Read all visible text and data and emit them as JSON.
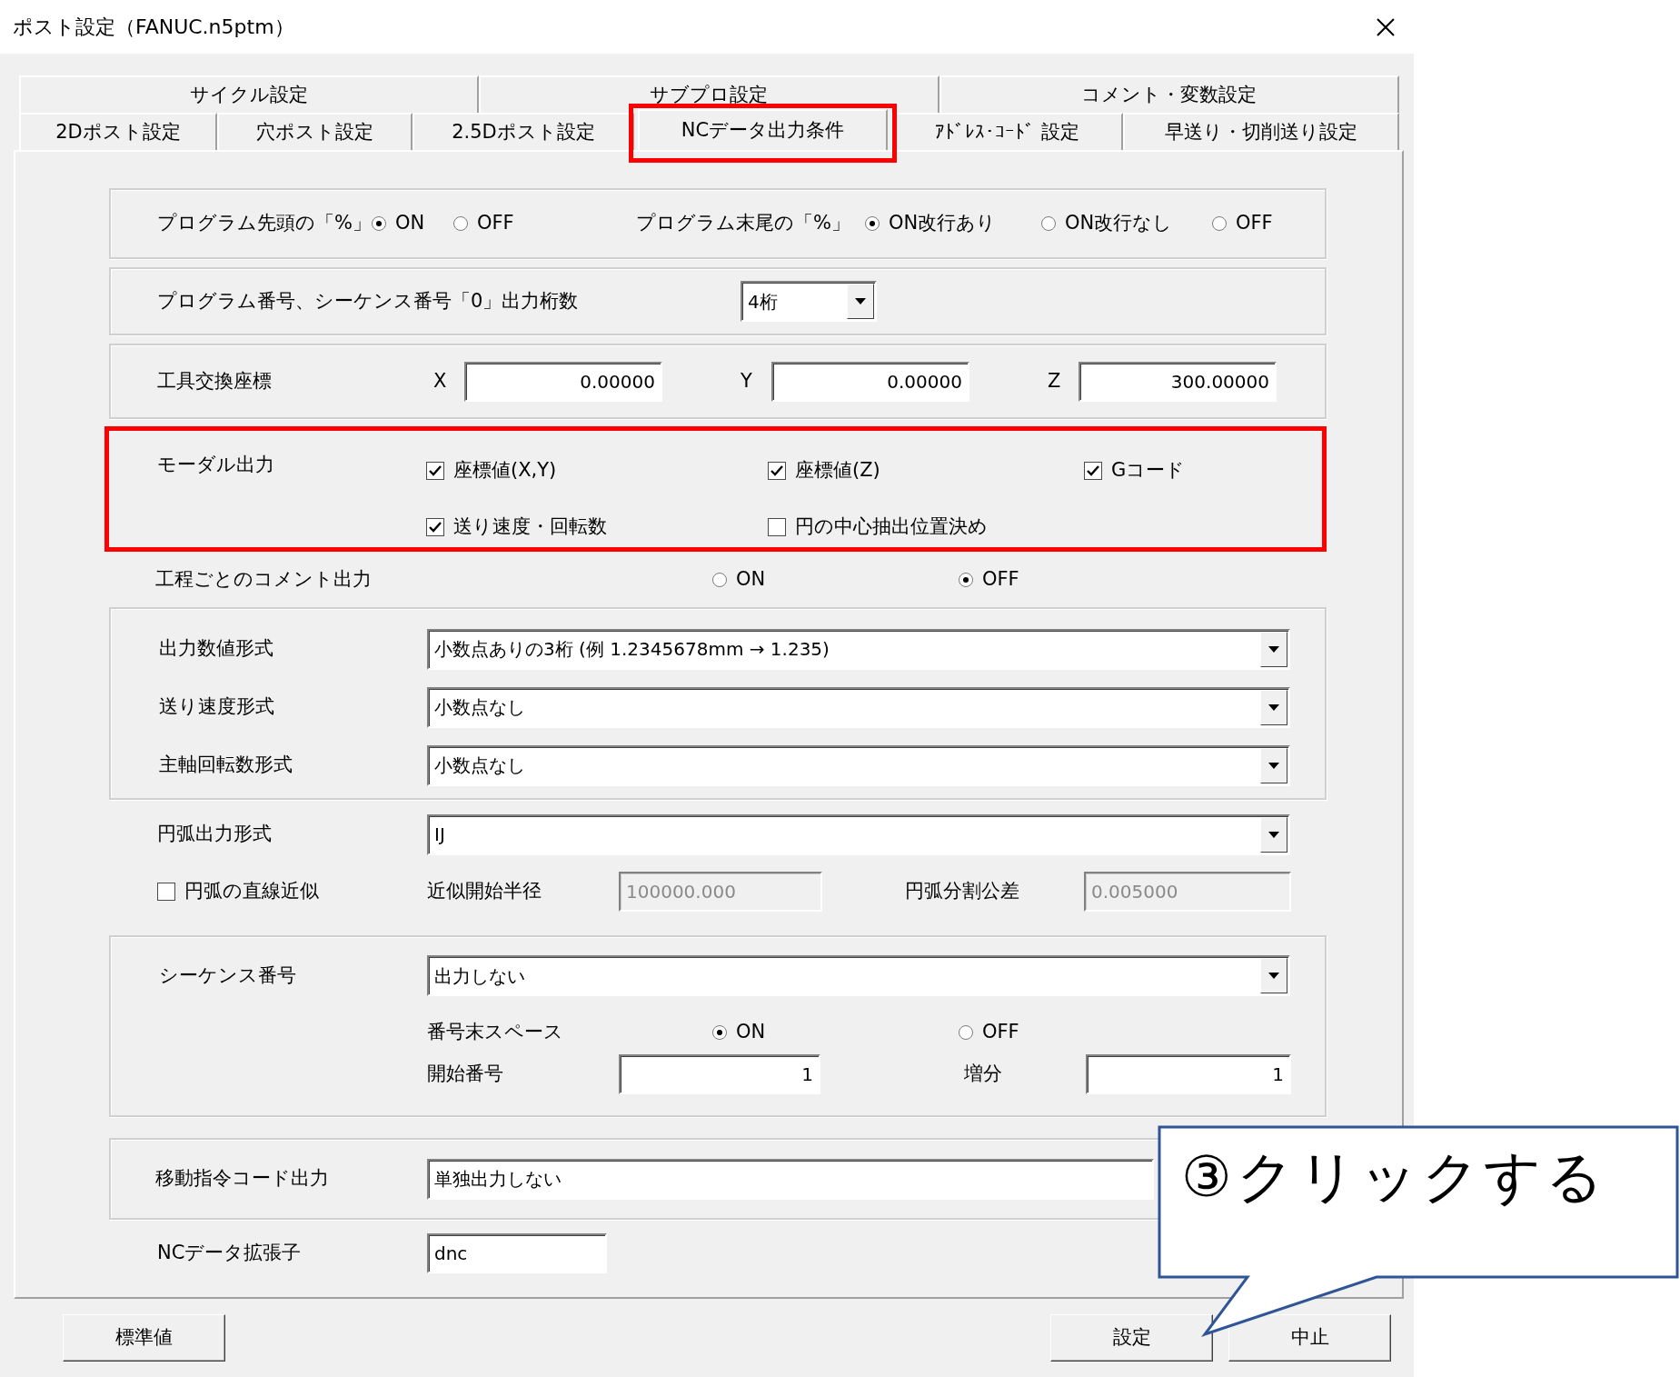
{
  "window": {
    "title": "ポスト設定（FANUC.n5ptm）"
  },
  "tab_rows": [
    {
      "tabs": [
        {
          "label": "サイクル設定",
          "selected": false,
          "highlighted": false
        },
        {
          "label": "サブプロ設定",
          "selected": false,
          "highlighted": false
        },
        {
          "label": "コメント・変数設定",
          "selected": false,
          "highlighted": false
        }
      ]
    },
    {
      "tabs": [
        {
          "label": "2Dポスト設定",
          "selected": false,
          "highlighted": false
        },
        {
          "label": "穴ポスト設定",
          "selected": false,
          "highlighted": false
        },
        {
          "label": "2.5Dポスト設定",
          "selected": false,
          "highlighted": false
        },
        {
          "label": "NCデータ出力条件",
          "selected": true,
          "highlighted": true
        },
        {
          "label": "ｱﾄﾞﾚｽ･ｺｰﾄﾞ 設定",
          "selected": false,
          "highlighted": false
        },
        {
          "label": "早送り・切削送り設定",
          "selected": false,
          "highlighted": false
        }
      ]
    }
  ],
  "percent": {
    "start_label": "プログラム先頭の「%」",
    "start_options": [
      {
        "label": "ON",
        "selected": true
      },
      {
        "label": "OFF",
        "selected": false
      }
    ],
    "end_label": "プログラム末尾の「%」",
    "end_options": [
      {
        "label": "ON改行あり",
        "selected": true
      },
      {
        "label": "ON改行なし",
        "selected": false
      },
      {
        "label": "OFF",
        "selected": false
      }
    ]
  },
  "digits": {
    "label": "プログラム番号、シーケンス番号「0」出力桁数",
    "value": "4桁"
  },
  "tool_change": {
    "label": "工具交換座標",
    "fields": [
      {
        "axis": "X",
        "value": "0.00000"
      },
      {
        "axis": "Y",
        "value": "0.00000"
      },
      {
        "axis": "Z",
        "value": "300.00000"
      }
    ]
  },
  "modal": {
    "label": "モーダル出力",
    "highlighted": true,
    "options": [
      {
        "label": "座標値(X,Y)",
        "checked": true
      },
      {
        "label": "座標値(Z)",
        "checked": true
      },
      {
        "label": "Gコード",
        "checked": true
      },
      {
        "label": "送り速度・回転数",
        "checked": true
      },
      {
        "label": "円の中心抽出位置決め",
        "checked": false
      }
    ]
  },
  "comment": {
    "label": "工程ごとのコメント出力",
    "options": [
      {
        "label": "ON",
        "selected": false
      },
      {
        "label": "OFF",
        "selected": true
      }
    ]
  },
  "formats": [
    {
      "label": "出力数値形式",
      "value": "小数点ありの3桁 (例 1.2345678mm → 1.235)"
    },
    {
      "label": "送り速度形式",
      "value": "小数点なし"
    },
    {
      "label": "主軸回転数形式",
      "value": "小数点なし"
    }
  ],
  "arc": {
    "label": "円弧出力形式",
    "value": "IJ"
  },
  "linear_approx": {
    "label": "円弧の直線近似",
    "checked": false,
    "disabled": true,
    "radius_label": "近似開始半径",
    "radius": "100000.000",
    "tolerance_label": "円弧分割公差",
    "tolerance": "0.005000"
  },
  "sequence": {
    "label": "シーケンス番号",
    "value": "出力しない",
    "space_label": "番号末スペース",
    "space_options": [
      {
        "label": "ON",
        "selected": true
      },
      {
        "label": "OFF",
        "selected": false
      }
    ],
    "start_label": "開始番号",
    "start": "1",
    "step_label": "増分",
    "step": "1"
  },
  "move_code": {
    "label": "移動指令コード出力",
    "value": "単独出力しない"
  },
  "extension": {
    "label": "NCデータ拡張子",
    "value": "dnc"
  },
  "buttons": [
    {
      "label": "標準値"
    },
    {
      "label": "設定"
    },
    {
      "label": "中止"
    }
  ],
  "callout": {
    "text": "③クリックする"
  }
}
